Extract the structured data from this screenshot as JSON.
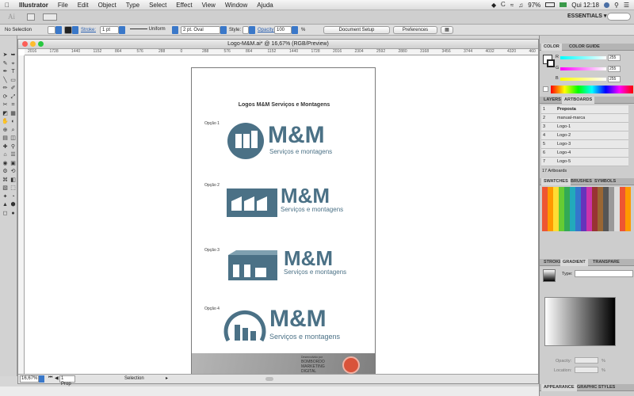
{
  "menubar": {
    "app": "Illustrator",
    "items": [
      "File",
      "Edit",
      "Object",
      "Type",
      "Select",
      "Effect",
      "View",
      "Window",
      "Ajuda"
    ],
    "battery": "97%",
    "time": "Qui 12:18"
  },
  "appbar": {
    "logo": "Ai",
    "workspace": "ESSENTIALS ▾"
  },
  "controlbar": {
    "selection": "No Selection",
    "stroke_label": "Stroke:",
    "stroke_value": "1 pt",
    "uniform": "Uniform",
    "brush": "2 pt. Oval",
    "style_label": "Style:",
    "opacity_label": "Opacity:",
    "opacity_value": "100",
    "opacity_unit": "%",
    "doc_setup": "Document Setup",
    "preferences": "Preferences"
  },
  "document": {
    "title": "Logo-M&M.ai* @ 16,67% (RGB/Preview)",
    "ruler_labels": [
      "2016",
      "1728",
      "1440",
      "1152",
      "864",
      "576",
      "288",
      "0",
      "288",
      "576",
      "864",
      "1152",
      "1440",
      "1728",
      "2016",
      "2304",
      "2592",
      "2880",
      "3168",
      "3456",
      "3744",
      "4032",
      "4320",
      "460"
    ],
    "zoom": "16,67%",
    "artboard_nav": "1 Prop",
    "status": "Selection"
  },
  "artboard": {
    "heading": "Logos M&M Serviços e Montagens",
    "options": [
      {
        "label": "Opção 1",
        "brand": "M&M",
        "tagline": "Serviços e montagens"
      },
      {
        "label": "Opção 2",
        "brand": "M&M",
        "tagline": "Serviços e montagens"
      },
      {
        "label": "Opção 3",
        "brand": "M&M",
        "tagline": "Serviços e montagens"
      },
      {
        "label": "Opção 4",
        "brand": "M&M",
        "tagline": "Serviços e montagens"
      }
    ],
    "footer": {
      "credit": "Desenvolvido por",
      "agency_lines": [
        "BOMBORDO",
        "MARKETING",
        "DIGITAL"
      ]
    }
  },
  "panels": {
    "color": {
      "tabs": [
        "COLOR",
        "COLOR GUIDE"
      ],
      "channels": [
        {
          "name": "R",
          "value": "255"
        },
        {
          "name": "G",
          "value": "255"
        },
        {
          "name": "B",
          "value": "255"
        }
      ]
    },
    "layers": {
      "tabs": [
        "LAYERS",
        "ARTBOARDS"
      ],
      "rows": [
        {
          "num": "1",
          "name": "Proposta"
        },
        {
          "num": "2",
          "name": "manual-marca"
        },
        {
          "num": "3",
          "name": "Logo-1"
        },
        {
          "num": "4",
          "name": "Logo-2"
        },
        {
          "num": "5",
          "name": "Logo-3"
        },
        {
          "num": "6",
          "name": "Logo-4"
        },
        {
          "num": "7",
          "name": "Logo-5"
        }
      ],
      "footer": "17 Artboards"
    },
    "swatches": {
      "tabs": [
        "SWATCHES",
        "BRUSHES",
        "SYMBOLS"
      ]
    },
    "gradient": {
      "tabs": [
        "STROKE",
        "GRADIENT",
        "TRANSPARE"
      ],
      "type_label": "Type:",
      "opacity_label": "Opacity:",
      "opacity_unit": "%",
      "location_label": "Location:",
      "location_unit": "%"
    },
    "bottom_tabs": [
      "APPEARANCE",
      "GRAPHIC STYLES"
    ]
  },
  "colors": {
    "brand": "#4b7186",
    "accent_blue": "#3a78c9",
    "footer_bg": "#9a9a9a",
    "footer_badge": "#d9533a"
  }
}
